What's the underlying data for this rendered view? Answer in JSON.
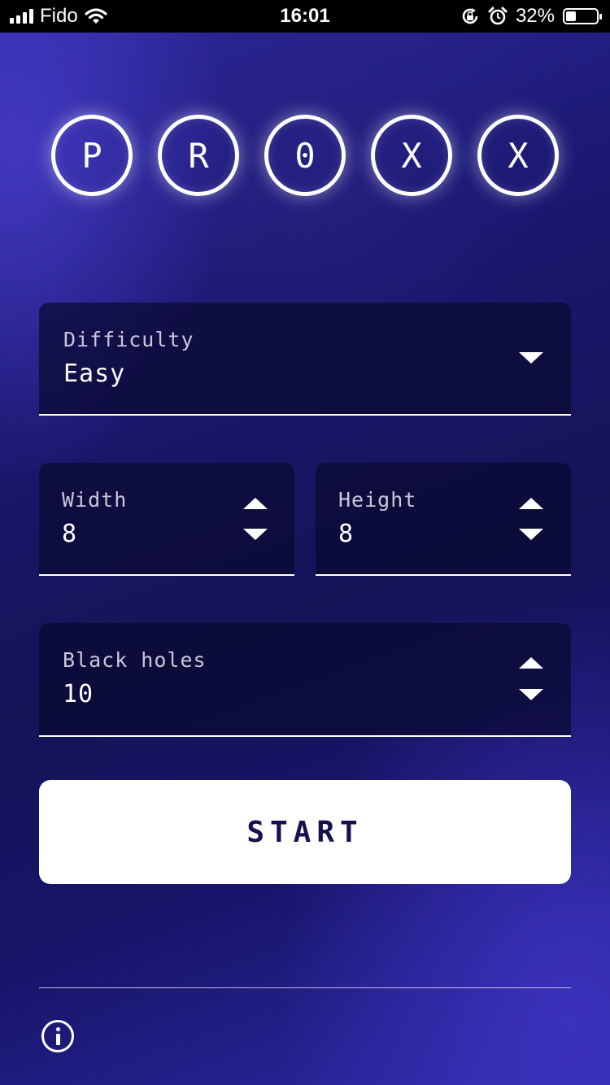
{
  "status_bar": {
    "carrier": "Fido",
    "time": "16:01",
    "battery_percent": "32%",
    "battery_level": 0.32,
    "icons": [
      "signal-icon",
      "wifi-icon",
      "rotation-lock-icon",
      "alarm-icon",
      "battery-icon"
    ]
  },
  "logo": {
    "letters": [
      "P",
      "R",
      "0",
      "X",
      "X"
    ]
  },
  "difficulty": {
    "label": "Difficulty",
    "value": "Easy"
  },
  "width": {
    "label": "Width",
    "value": "8"
  },
  "height": {
    "label": "Height",
    "value": "8"
  },
  "black_holes": {
    "label": "Black holes",
    "value": "10"
  },
  "start_button": {
    "label": "START"
  },
  "footer": {
    "info_icon": "info-icon"
  },
  "colors": {
    "background": "#1a1870",
    "field_bg": "#0a0a30",
    "button_text": "#15124f",
    "accent": "#2f2aa3"
  }
}
